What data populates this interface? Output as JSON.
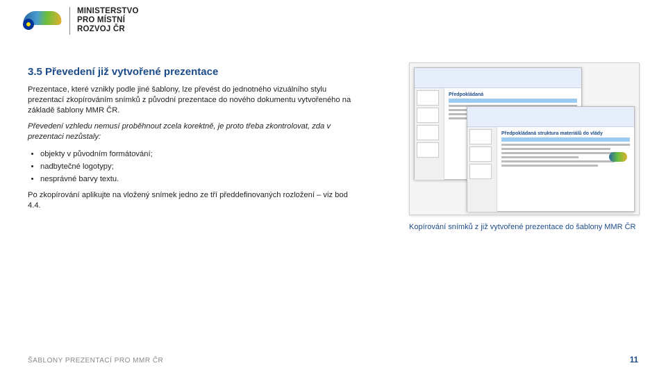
{
  "header": {
    "org_line1": "MINISTERSTVO",
    "org_line2": "PRO MÍSTNÍ",
    "org_line3": "ROZVOJ ČR"
  },
  "section": {
    "title": "3.5 Převedení již vytvořené prezentace",
    "p1": "Prezentace, které vznikly podle jiné šablony, lze převést do jednotného vizuálního stylu prezentací zkopírováním snímků z původní prezentace do nového dokumentu vytvořeného na základě šablony MMR ČR.",
    "p2": "Převedení vzhledu nemusí proběhnout zcela korektně, je proto třeba zkontrolovat, zda v prezentaci nezůstaly:",
    "bullets": [
      "objekty v původním formátování;",
      "nadbytečné logotypy;",
      "nesprávné barvy textu."
    ],
    "p3": "Po zkopírování aplikujte na vložený snímek jedno ze tří předdefinovaných rozložení – viz bod 4.4."
  },
  "figure": {
    "back_slide_title": "Předpokládaná",
    "front_slide_title": "Předpokládaná struktura materiálů do vlády",
    "caption": "Kopírování snímků z již vytvořené prezentace do šablony MMR ČR"
  },
  "footer": {
    "left": "ŠABLONY PREZENTACÍ PRO MMR ČR",
    "page": "11"
  }
}
